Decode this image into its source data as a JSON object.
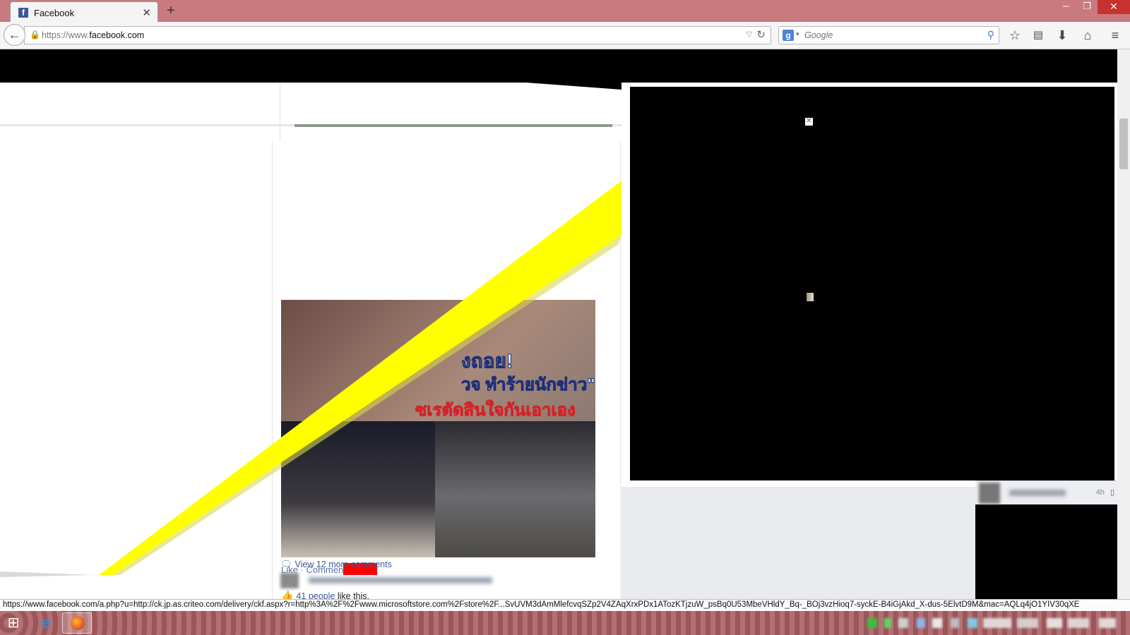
{
  "browser": {
    "tab": {
      "title": "Facebook",
      "icon": "facebook-icon"
    },
    "new_tab_glyph": "+",
    "url": {
      "prefix": "https://www.",
      "domain": "facebook.com"
    },
    "search": {
      "engine_icon": "google-icon",
      "placeholder": "Google"
    },
    "toolbar_icons": [
      "bookmark-star-icon",
      "reading-list-icon",
      "download-icon",
      "home-icon",
      "menu-icon"
    ]
  },
  "post": {
    "image_text": {
      "line1": "งถอย!",
      "line2": "วจ ทำร้ายนักข่าว\"",
      "line3": "ซเรตัดสินใจกันเอาเอง"
    },
    "actions": {
      "like": "Like",
      "separator": "·",
      "comment": "Commen"
    },
    "likes": {
      "count": "41 people",
      "suffix": "like this."
    },
    "more_comments": "View 12 more comments"
  },
  "chat": {
    "time": "4h"
  },
  "status_url": "https://www.facebook.com/a.php?u=http://ck.jp.as.criteo.com/delivery/ckf.aspx?r=http%3A%2F%2Fwww.microsoftstore.com%2Fstore%2F...SvUVM3dAmMlefcvqSZp2V4ZAqXrxPDx1ATozKTjzuW_psBq0U53MbeVHldY_Bq-_BOj3vzHioq7-syckE-B4iGjAkd_X-dus-5ElvtD9M&mac=AQLq4jO1YIV30qXE",
  "colors": {
    "titlebar": "#c97a7e",
    "facebook_blue": "#3b5998",
    "overlay_yellow": "#ffff00",
    "redaction_red": "#ff0000"
  }
}
